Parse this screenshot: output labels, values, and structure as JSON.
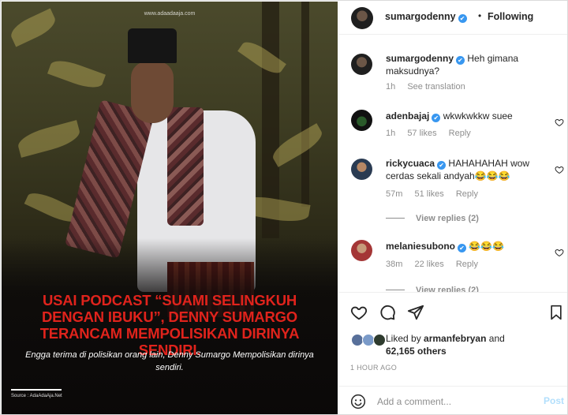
{
  "image": {
    "watermark": "www.adaadaaja.com",
    "headline": "USAI PODCAST “SUAMI SELINGKUH DENGAN IBUKU”, DENNY SUMARGO TERANCAM MEMPOLISIKAN DIRINYA SENDIRI.",
    "subline": "Engga terima di polisikan orang lain, Denny Sumargo Mempolisikan dirinya sendiri.",
    "source": "Source : AdaAdaAja.Net",
    "headline_color": "#e0231c"
  },
  "header": {
    "username": "sumargodenny",
    "verified_icon": "✔",
    "dot": "•",
    "follow_status": "Following"
  },
  "comments": [
    {
      "username": "sumargodenny",
      "verified": true,
      "text": "Heh gimana maksudnya?",
      "time": "1h",
      "extra": "See translation",
      "likes": "",
      "reply": ""
    },
    {
      "username": "adenbajaj",
      "verified": true,
      "text": "wkwkwkkw suee",
      "time": "1h",
      "likes": "57 likes",
      "reply": "Reply"
    },
    {
      "username": "rickycuaca",
      "verified": true,
      "text": "HAHAHAHAH wow cerdas sekali andyah😂😂😂",
      "time": "57m",
      "likes": "51 likes",
      "reply": "Reply",
      "view_replies": "View replies (2)"
    },
    {
      "username": "melaniesubono",
      "verified": true,
      "text": "😂😂😂",
      "time": "38m",
      "likes": "22 likes",
      "reply": "Reply",
      "view_replies": "View replies (2)"
    }
  ],
  "actions": {
    "liked_by_prefix": "Liked by",
    "liked_by_user": "armanfebryan",
    "liked_by_and": "and",
    "likes_count": "62,165 others",
    "timestamp": "1 HOUR AGO"
  },
  "add_comment": {
    "placeholder": "Add a comment...",
    "post_label": "Post"
  },
  "colors": {
    "accent": "#3897f0",
    "post_button_disabled": "#b2dffc",
    "secondary_text": "#8e8e8e"
  }
}
